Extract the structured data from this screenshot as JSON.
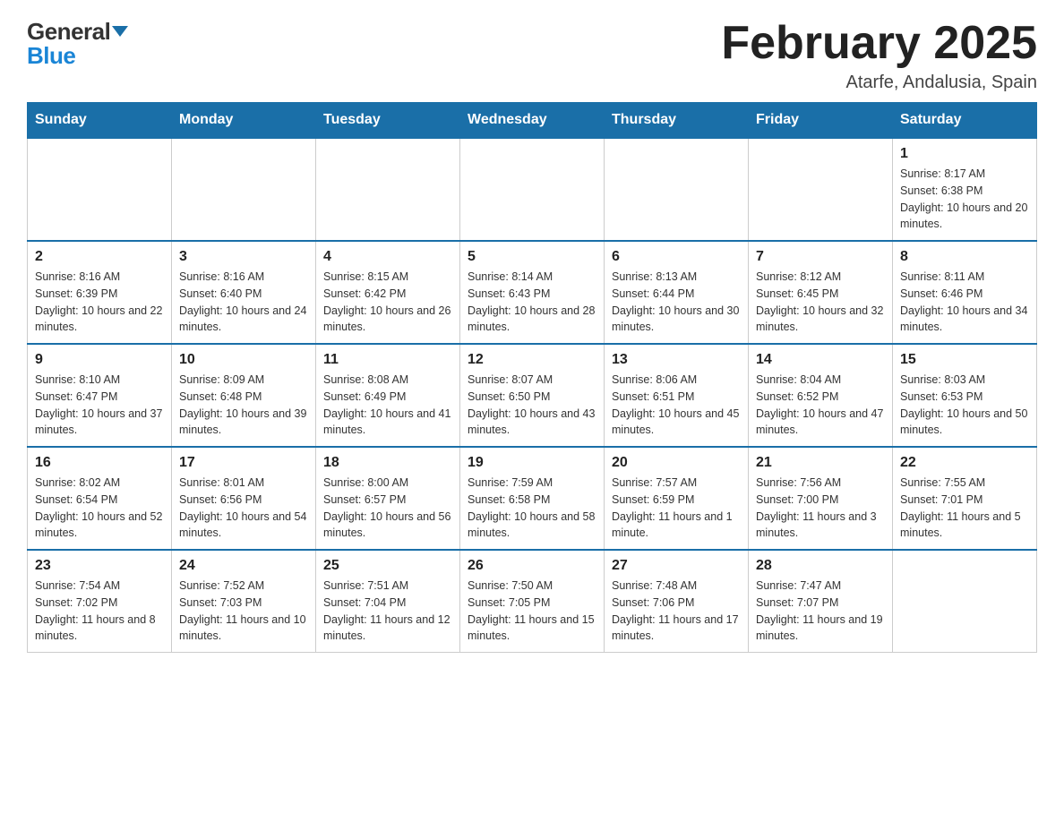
{
  "header": {
    "logo_general": "General",
    "logo_blue": "Blue",
    "title": "February 2025",
    "subtitle": "Atarfe, Andalusia, Spain"
  },
  "weekdays": [
    "Sunday",
    "Monday",
    "Tuesday",
    "Wednesday",
    "Thursday",
    "Friday",
    "Saturday"
  ],
  "weeks": [
    [
      {
        "day": "",
        "info": ""
      },
      {
        "day": "",
        "info": ""
      },
      {
        "day": "",
        "info": ""
      },
      {
        "day": "",
        "info": ""
      },
      {
        "day": "",
        "info": ""
      },
      {
        "day": "",
        "info": ""
      },
      {
        "day": "1",
        "info": "Sunrise: 8:17 AM\nSunset: 6:38 PM\nDaylight: 10 hours and 20 minutes."
      }
    ],
    [
      {
        "day": "2",
        "info": "Sunrise: 8:16 AM\nSunset: 6:39 PM\nDaylight: 10 hours and 22 minutes."
      },
      {
        "day": "3",
        "info": "Sunrise: 8:16 AM\nSunset: 6:40 PM\nDaylight: 10 hours and 24 minutes."
      },
      {
        "day": "4",
        "info": "Sunrise: 8:15 AM\nSunset: 6:42 PM\nDaylight: 10 hours and 26 minutes."
      },
      {
        "day": "5",
        "info": "Sunrise: 8:14 AM\nSunset: 6:43 PM\nDaylight: 10 hours and 28 minutes."
      },
      {
        "day": "6",
        "info": "Sunrise: 8:13 AM\nSunset: 6:44 PM\nDaylight: 10 hours and 30 minutes."
      },
      {
        "day": "7",
        "info": "Sunrise: 8:12 AM\nSunset: 6:45 PM\nDaylight: 10 hours and 32 minutes."
      },
      {
        "day": "8",
        "info": "Sunrise: 8:11 AM\nSunset: 6:46 PM\nDaylight: 10 hours and 34 minutes."
      }
    ],
    [
      {
        "day": "9",
        "info": "Sunrise: 8:10 AM\nSunset: 6:47 PM\nDaylight: 10 hours and 37 minutes."
      },
      {
        "day": "10",
        "info": "Sunrise: 8:09 AM\nSunset: 6:48 PM\nDaylight: 10 hours and 39 minutes."
      },
      {
        "day": "11",
        "info": "Sunrise: 8:08 AM\nSunset: 6:49 PM\nDaylight: 10 hours and 41 minutes."
      },
      {
        "day": "12",
        "info": "Sunrise: 8:07 AM\nSunset: 6:50 PM\nDaylight: 10 hours and 43 minutes."
      },
      {
        "day": "13",
        "info": "Sunrise: 8:06 AM\nSunset: 6:51 PM\nDaylight: 10 hours and 45 minutes."
      },
      {
        "day": "14",
        "info": "Sunrise: 8:04 AM\nSunset: 6:52 PM\nDaylight: 10 hours and 47 minutes."
      },
      {
        "day": "15",
        "info": "Sunrise: 8:03 AM\nSunset: 6:53 PM\nDaylight: 10 hours and 50 minutes."
      }
    ],
    [
      {
        "day": "16",
        "info": "Sunrise: 8:02 AM\nSunset: 6:54 PM\nDaylight: 10 hours and 52 minutes."
      },
      {
        "day": "17",
        "info": "Sunrise: 8:01 AM\nSunset: 6:56 PM\nDaylight: 10 hours and 54 minutes."
      },
      {
        "day": "18",
        "info": "Sunrise: 8:00 AM\nSunset: 6:57 PM\nDaylight: 10 hours and 56 minutes."
      },
      {
        "day": "19",
        "info": "Sunrise: 7:59 AM\nSunset: 6:58 PM\nDaylight: 10 hours and 58 minutes."
      },
      {
        "day": "20",
        "info": "Sunrise: 7:57 AM\nSunset: 6:59 PM\nDaylight: 11 hours and 1 minute."
      },
      {
        "day": "21",
        "info": "Sunrise: 7:56 AM\nSunset: 7:00 PM\nDaylight: 11 hours and 3 minutes."
      },
      {
        "day": "22",
        "info": "Sunrise: 7:55 AM\nSunset: 7:01 PM\nDaylight: 11 hours and 5 minutes."
      }
    ],
    [
      {
        "day": "23",
        "info": "Sunrise: 7:54 AM\nSunset: 7:02 PM\nDaylight: 11 hours and 8 minutes."
      },
      {
        "day": "24",
        "info": "Sunrise: 7:52 AM\nSunset: 7:03 PM\nDaylight: 11 hours and 10 minutes."
      },
      {
        "day": "25",
        "info": "Sunrise: 7:51 AM\nSunset: 7:04 PM\nDaylight: 11 hours and 12 minutes."
      },
      {
        "day": "26",
        "info": "Sunrise: 7:50 AM\nSunset: 7:05 PM\nDaylight: 11 hours and 15 minutes."
      },
      {
        "day": "27",
        "info": "Sunrise: 7:48 AM\nSunset: 7:06 PM\nDaylight: 11 hours and 17 minutes."
      },
      {
        "day": "28",
        "info": "Sunrise: 7:47 AM\nSunset: 7:07 PM\nDaylight: 11 hours and 19 minutes."
      },
      {
        "day": "",
        "info": ""
      }
    ]
  ]
}
